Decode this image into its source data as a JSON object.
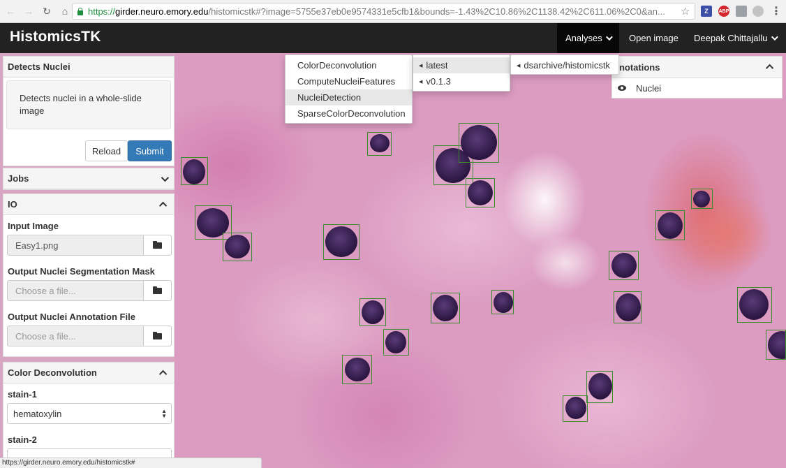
{
  "browser": {
    "url_scheme": "https://",
    "url_host": "girder.neuro.emory.edu",
    "url_rest": "/histomicstk#?image=5755e37eb0e9574331e5cfb1&bounds=-1.43%2C10.86%2C1138.42%2C611.06%2C0&an...",
    "extensions": [
      "Z",
      "ABP"
    ],
    "status_url": "https://girder.neuro.emory.edu/histomicstk#"
  },
  "navbar": {
    "brand": "HistomicsTK",
    "analyses": "Analyses",
    "open_image": "Open image",
    "user": "Deepak Chittajallu"
  },
  "analyses_menu": {
    "items": [
      "ColorDeconvolution",
      "ComputeNucleiFeatures",
      "NucleiDetection",
      "SparseColorDeconvolution"
    ],
    "highlighted": "NucleiDetection",
    "versions": [
      "latest",
      "v0.1.3"
    ],
    "repos": [
      "dsarchive/histomicstk"
    ]
  },
  "left_panel": {
    "task_title": "Detects Nuclei",
    "task_description": "Detects nuclei in a whole-slide image",
    "reload_label": "Reload",
    "submit_label": "Submit",
    "jobs_title": "Jobs",
    "io_title": "IO",
    "input_image_label": "Input Image",
    "input_image_value": "Easy1.png",
    "output_mask_label": "Output Nuclei Segmentation Mask",
    "output_mask_placeholder": "Choose a file...",
    "output_annotation_label": "Output Nuclei Annotation File",
    "output_annotation_placeholder": "Choose a file...",
    "color_deconv_title": "Color Deconvolution",
    "stain1_label": "stain-1",
    "stain1_value": "hematoxylin",
    "stain2_label": "stain-2"
  },
  "annotations_panel": {
    "title": "nnotations",
    "items": [
      "Nuclei"
    ]
  }
}
